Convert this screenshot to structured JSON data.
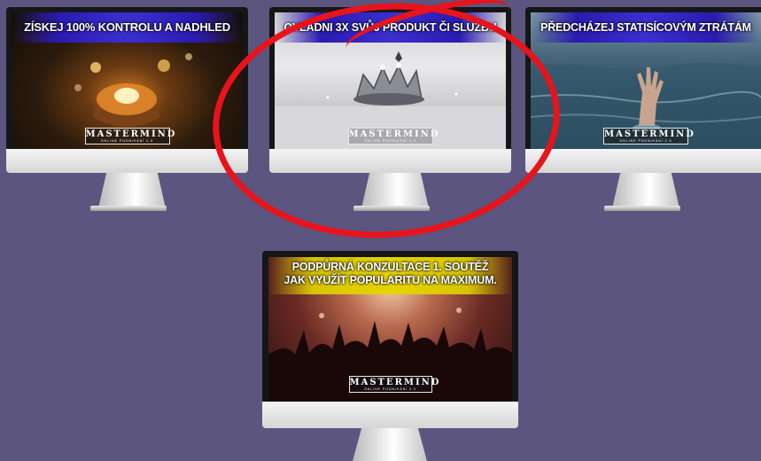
{
  "monitors": [
    {
      "title_lines": [
        "ZÍSKEJ 100% KONTROLU A NADHLED"
      ],
      "scene_icon": "candle-hands-image",
      "brand_name": "MASTERMIND",
      "brand_sub": "ONLINE PODNIKÁNÍ 2.0",
      "banner_color": "#2a1ab0",
      "circled": false
    },
    {
      "title_lines": [
        "OVLÁDNI 3X SVŮJ PRODUKT ČI SLUŽBU"
      ],
      "scene_icon": "crown-image",
      "brand_name": "MASTERMIND",
      "brand_sub": "ONLINE PODNIKÁNÍ 2.0",
      "banner_color": "#2a1ab0",
      "circled": true
    },
    {
      "title_lines": [
        "PŘEDCHÁZEJ STATISÍCOVÝM ZTRÁTÁM"
      ],
      "scene_icon": "hand-in-water-image",
      "brand_name": "MASTERMIND",
      "brand_sub": "ONLINE PODNIKÁNÍ 2.0",
      "banner_color": "#2a1ab0",
      "circled": false
    },
    {
      "title_lines": [
        "PODPŮRNÁ KONZULTACE 1. SOUTĚŽ",
        "JAK VYUŽÍT POPULARITU NA MAXIMUM."
      ],
      "scene_icon": "concert-crowd-image",
      "brand_name": "MASTERMIND",
      "brand_sub": "ONLINE PODNIKÁNÍ 2.0",
      "banner_color": "#d8c300",
      "circled": false
    }
  ],
  "highlight_color": "#e7141b"
}
